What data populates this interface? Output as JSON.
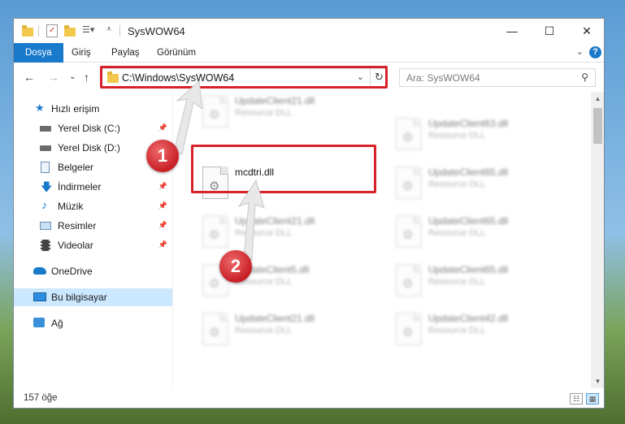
{
  "window": {
    "title": "SysWOW64",
    "controls": {
      "minimize": "—",
      "maximize": "☐",
      "close": "✕"
    }
  },
  "ribbon": {
    "tabs": [
      {
        "label": "Dosya",
        "active": true
      },
      {
        "label": "Giriş"
      },
      {
        "label": "Paylaş"
      },
      {
        "label": "Görünüm"
      }
    ],
    "help": "?",
    "collapse": "⌄"
  },
  "nav": {
    "back": "←",
    "forward": "→",
    "recent": "⌄",
    "up": "↑",
    "address": "C:\\Windows\\SysWOW64",
    "address_dropdown": "⌄",
    "refresh": "↻",
    "search_placeholder": "Ara: SysWOW64",
    "search_icon": "⚲"
  },
  "sidebar": {
    "items": [
      {
        "label": "Hızlı erişim",
        "icon": "star-icon",
        "pinned": false
      },
      {
        "label": "Yerel Disk (C:)",
        "icon": "drive-icon",
        "pinned": true
      },
      {
        "label": "Yerel Disk (D:)",
        "icon": "drive-icon",
        "pinned": true
      },
      {
        "label": "Belgeler",
        "icon": "documents-icon",
        "pinned": true
      },
      {
        "label": "İndirmeler",
        "icon": "download-icon",
        "pinned": true
      },
      {
        "label": "Müzik",
        "icon": "music-icon",
        "pinned": true
      },
      {
        "label": "Resimler",
        "icon": "pictures-icon",
        "pinned": true
      },
      {
        "label": "Videolar",
        "icon": "videos-icon",
        "pinned": true
      },
      {
        "label": "OneDrive",
        "icon": "cloud-icon",
        "pinned": false
      },
      {
        "label": "Bu bilgisayar",
        "icon": "computer-icon",
        "pinned": false,
        "selected": true
      },
      {
        "label": "Ağ",
        "icon": "network-icon",
        "pinned": false
      }
    ],
    "pin_glyph": "📌"
  },
  "files": {
    "highlighted": {
      "name": "mcdtri.dll",
      "type": ""
    },
    "left_column": [
      {
        "name": "UpdateClient21.dll",
        "type": "Resource DLL"
      },
      {
        "name": "UpdateClient21.dll",
        "type": "Resource DLL"
      },
      {
        "name": "UpdateClient5.dll",
        "type": "Resource DLL"
      },
      {
        "name": "UpdateClient21.dll",
        "type": "Resource DLL"
      }
    ],
    "right_column": [
      {
        "name": "UpdateClient63.dll",
        "type": "Resource DLL"
      },
      {
        "name": "UpdateClient65.dll",
        "type": "Resource DLL"
      },
      {
        "name": "UpdateClient65.dll",
        "type": "Resource DLL"
      },
      {
        "name": "UpdateClient65.dll",
        "type": "Resource DLL"
      },
      {
        "name": "UpdateClient42.dll",
        "type": "Resource DLL"
      }
    ]
  },
  "markers": {
    "one": "1",
    "two": "2"
  },
  "status": {
    "count": "157 öğe"
  },
  "colors": {
    "accent": "#1979ca",
    "highlight": "#d8212a",
    "selection": "#cce8ff"
  }
}
